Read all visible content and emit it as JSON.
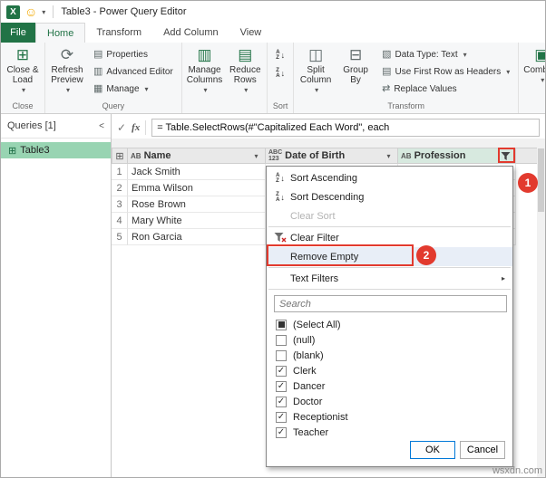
{
  "titlebar": {
    "title": "Table3 - Power Query Editor"
  },
  "tabs": {
    "file": "File",
    "home": "Home",
    "transform": "Transform",
    "add_column": "Add Column",
    "view": "View"
  },
  "ribbon": {
    "groups": {
      "close": "Close",
      "query": "Query",
      "sort": "Sort",
      "transform": "Transform"
    },
    "buttons": {
      "close_load": "Close &\nLoad",
      "refresh_preview": "Refresh\nPreview",
      "properties": "Properties",
      "advanced_editor": "Advanced Editor",
      "manage": "Manage",
      "manage_columns": "Manage\nColumns",
      "reduce_rows": "Reduce\nRows",
      "split_column": "Split\nColumn",
      "group_by": "Group\nBy",
      "data_type": "Data Type: Text",
      "use_first_row": "Use First Row as Headers",
      "replace_values": "Replace Values",
      "combine": "Combine"
    }
  },
  "queries_pane": {
    "header": "Queries [1]",
    "items": [
      {
        "label": "Table3"
      }
    ]
  },
  "formula_bar": {
    "formula": "= Table.SelectRows(#\"Capitalized Each Word\", each"
  },
  "grid": {
    "columns": [
      {
        "type_icon": "AB",
        "label": "Name"
      },
      {
        "type_icon": "ABC\n123",
        "label": "Date of Birth"
      },
      {
        "type_icon": "AB",
        "label": "Profession"
      }
    ],
    "rows": [
      {
        "num": "1",
        "name": "Jack Smith"
      },
      {
        "num": "2",
        "name": "Emma Wilson"
      },
      {
        "num": "3",
        "name": "Rose Brown"
      },
      {
        "num": "4",
        "name": "Mary White"
      },
      {
        "num": "5",
        "name": "Ron Garcia"
      }
    ]
  },
  "filter_menu": {
    "items": [
      {
        "label": "Sort Ascending",
        "state": "normal"
      },
      {
        "label": "Sort Descending",
        "state": "normal"
      },
      {
        "label": "Clear Sort",
        "state": "disabled"
      },
      {
        "label": "Clear Filter",
        "state": "normal"
      },
      {
        "label": "Remove Empty",
        "state": "highlighted"
      },
      {
        "label": "Text Filters",
        "state": "normal"
      }
    ],
    "search_placeholder": "Search",
    "checkboxes": [
      {
        "label": "(Select All)",
        "state": "partial"
      },
      {
        "label": "(null)",
        "state": "unchecked"
      },
      {
        "label": "(blank)",
        "state": "unchecked"
      },
      {
        "label": "Clerk",
        "state": "checked"
      },
      {
        "label": "Dancer",
        "state": "checked"
      },
      {
        "label": "Doctor",
        "state": "checked"
      },
      {
        "label": "Receptionist",
        "state": "checked"
      },
      {
        "label": "Teacher",
        "state": "checked"
      }
    ],
    "ok_label": "OK",
    "cancel_label": "Cancel"
  },
  "annotations": {
    "step1": "1",
    "step2": "2"
  },
  "watermark": "wsxdn.com",
  "icons": {
    "excel": "X",
    "smiley": "☺",
    "caret": "▾",
    "collapse": "<",
    "check": "✓",
    "fx": "fx",
    "grid": "⊞",
    "refresh": "⟳",
    "doc": "▤",
    "manage": "▦",
    "columns": "▥",
    "rows": "▤",
    "split": "◫",
    "group": "⊟",
    "swap": "⇄",
    "combine": "▣",
    "datatype": "▧",
    "firstrow": "▤",
    "az_asc": "A\nZ",
    "az_desc": "Z\nA",
    "down_arrow": "↓",
    "submenu": "▸",
    "table": "⊞"
  }
}
